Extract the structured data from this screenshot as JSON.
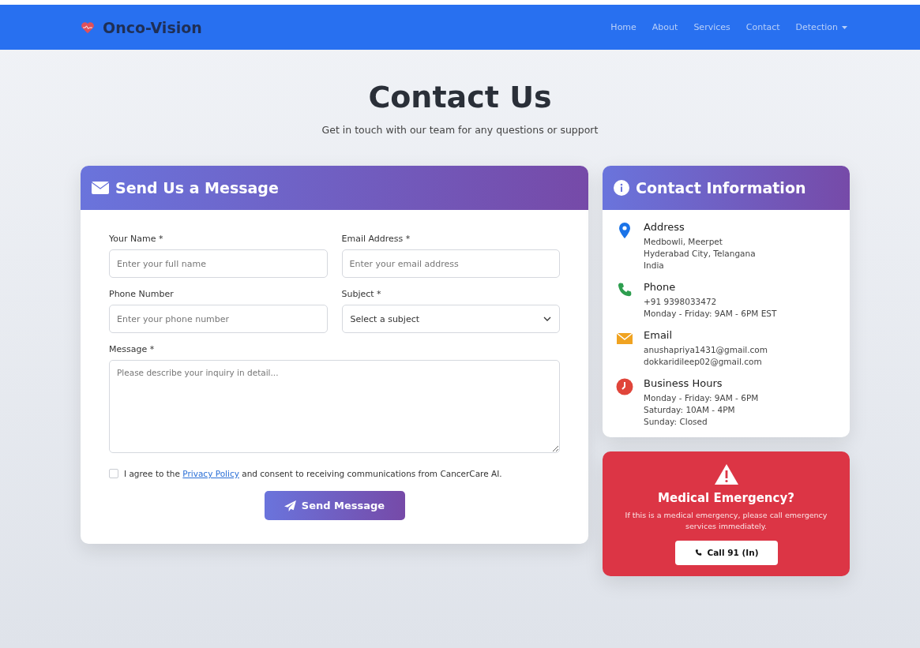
{
  "navbar": {
    "brand": "Onco-Vision",
    "links": [
      {
        "label": "Home",
        "dropdown": false
      },
      {
        "label": "About",
        "dropdown": false
      },
      {
        "label": "Services",
        "dropdown": false
      },
      {
        "label": "Contact",
        "dropdown": false
      },
      {
        "label": "Detection",
        "dropdown": true
      }
    ]
  },
  "header": {
    "title": "Contact Us",
    "subtitle": "Get in touch with our team for any questions or support"
  },
  "form": {
    "title": "Send Us a Message",
    "fields": [
      {
        "kind": "input",
        "label": "Your Name *",
        "placeholder": "Enter your full name"
      },
      {
        "kind": "input",
        "label": "Email Address *",
        "placeholder": "Enter your email address"
      },
      {
        "kind": "input",
        "label": "Phone Number",
        "placeholder": "Enter your phone number"
      },
      {
        "kind": "select",
        "label": "Subject *",
        "value": "Select a subject"
      },
      {
        "kind": "textarea",
        "label": "Message *",
        "placeholder": "Please describe your inquiry in detail..."
      }
    ],
    "consent": {
      "checked": false,
      "before": "I agree to the",
      "link": "Privacy Policy",
      "after": "and consent to receiving communications from CancerCare AI."
    },
    "submit": "Send Message"
  },
  "contact_info": {
    "title": "Contact Information",
    "items": [
      {
        "kind": "address",
        "color": "#1a73e8",
        "heading": "Address",
        "lines": [
          "Medbowli, Meerpet",
          "Hyderabad City, Telangana",
          "India"
        ]
      },
      {
        "kind": "phone",
        "color": "#2e9e4f",
        "heading": "Phone",
        "lines": [
          "+91 9398033472",
          "Monday - Friday: 9AM - 6PM EST"
        ]
      },
      {
        "kind": "email",
        "color": "#f0a321",
        "heading": "Email",
        "lines": [
          "anushapriya1431@gmail.com",
          "dokkaridileep02@gmail.com"
        ]
      },
      {
        "kind": "hours",
        "color": "#e0453a",
        "heading": "Business Hours",
        "lines": [
          "Monday - Friday: 9AM - 6PM",
          "Saturday: 10AM - 4PM",
          "Sunday: Closed"
        ]
      }
    ]
  },
  "emergency": {
    "title": "Medical Emergency?",
    "text": "If this is a medical emergency, please call emergency services immediately.",
    "button": "Call 91 (In)"
  }
}
